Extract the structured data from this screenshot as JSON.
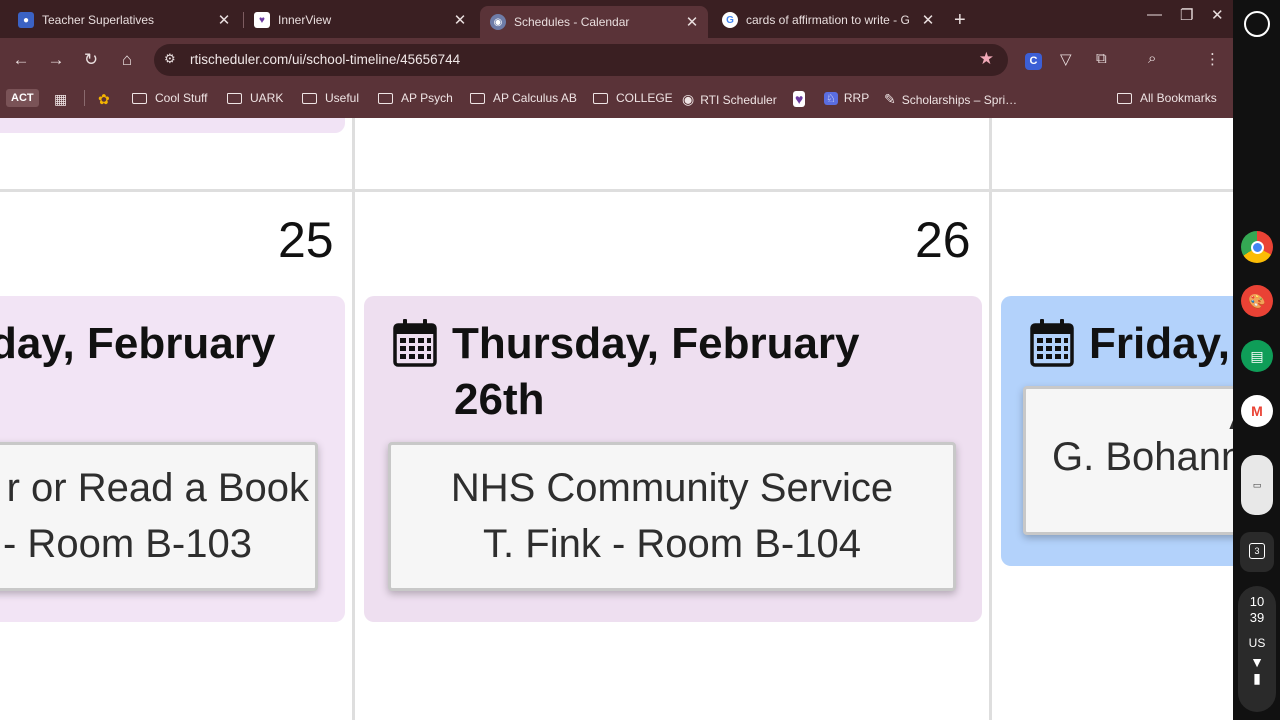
{
  "tabs": [
    {
      "title": "Teacher Superlatives",
      "icon": "profile-icon"
    },
    {
      "title": "InnerView",
      "icon": "innerview-icon"
    },
    {
      "title": "Schedules - Calendar",
      "icon": "rti-icon",
      "active": true
    },
    {
      "title": "cards of affirmation to write - G",
      "icon": "google-icon"
    }
  ],
  "toolbar": {
    "url": "rtischeduler.com/ui/school-timeline/45656744"
  },
  "bookmarks": {
    "act": "ACT",
    "items": [
      "Cool Stuff",
      "UARK",
      "Useful",
      "AP Psych",
      "AP Calculus AB",
      "COLLEGE",
      "RTI Scheduler",
      "RRP",
      "Scholarships – Spri…",
      "All Bookmarks"
    ]
  },
  "calendar": {
    "days": [
      {
        "num": "25",
        "title_line1": "day, February",
        "event_line1": "r or Read a Book",
        "event_line2": "- Room B-103"
      },
      {
        "num": "26",
        "title_line1": "Thursday, February",
        "title_line2": "26th",
        "event_line1": "NHS Community Service",
        "event_line2": "T. Fink - Room B-104"
      },
      {
        "title_line1": "Friday,",
        "event_line1": "A",
        "event_line2": "G. Bohann"
      }
    ]
  },
  "shelf": {
    "time_hour": "10",
    "time_min": "39",
    "locale": "US",
    "notif_count": "3"
  },
  "colors": {
    "tab_bg": "#3a1f22",
    "toolbar_bg": "#5a3338",
    "card_purple": "#eedff0",
    "card_purple_left": "#f2e4f5",
    "card_blue": "#b3d2fb"
  }
}
